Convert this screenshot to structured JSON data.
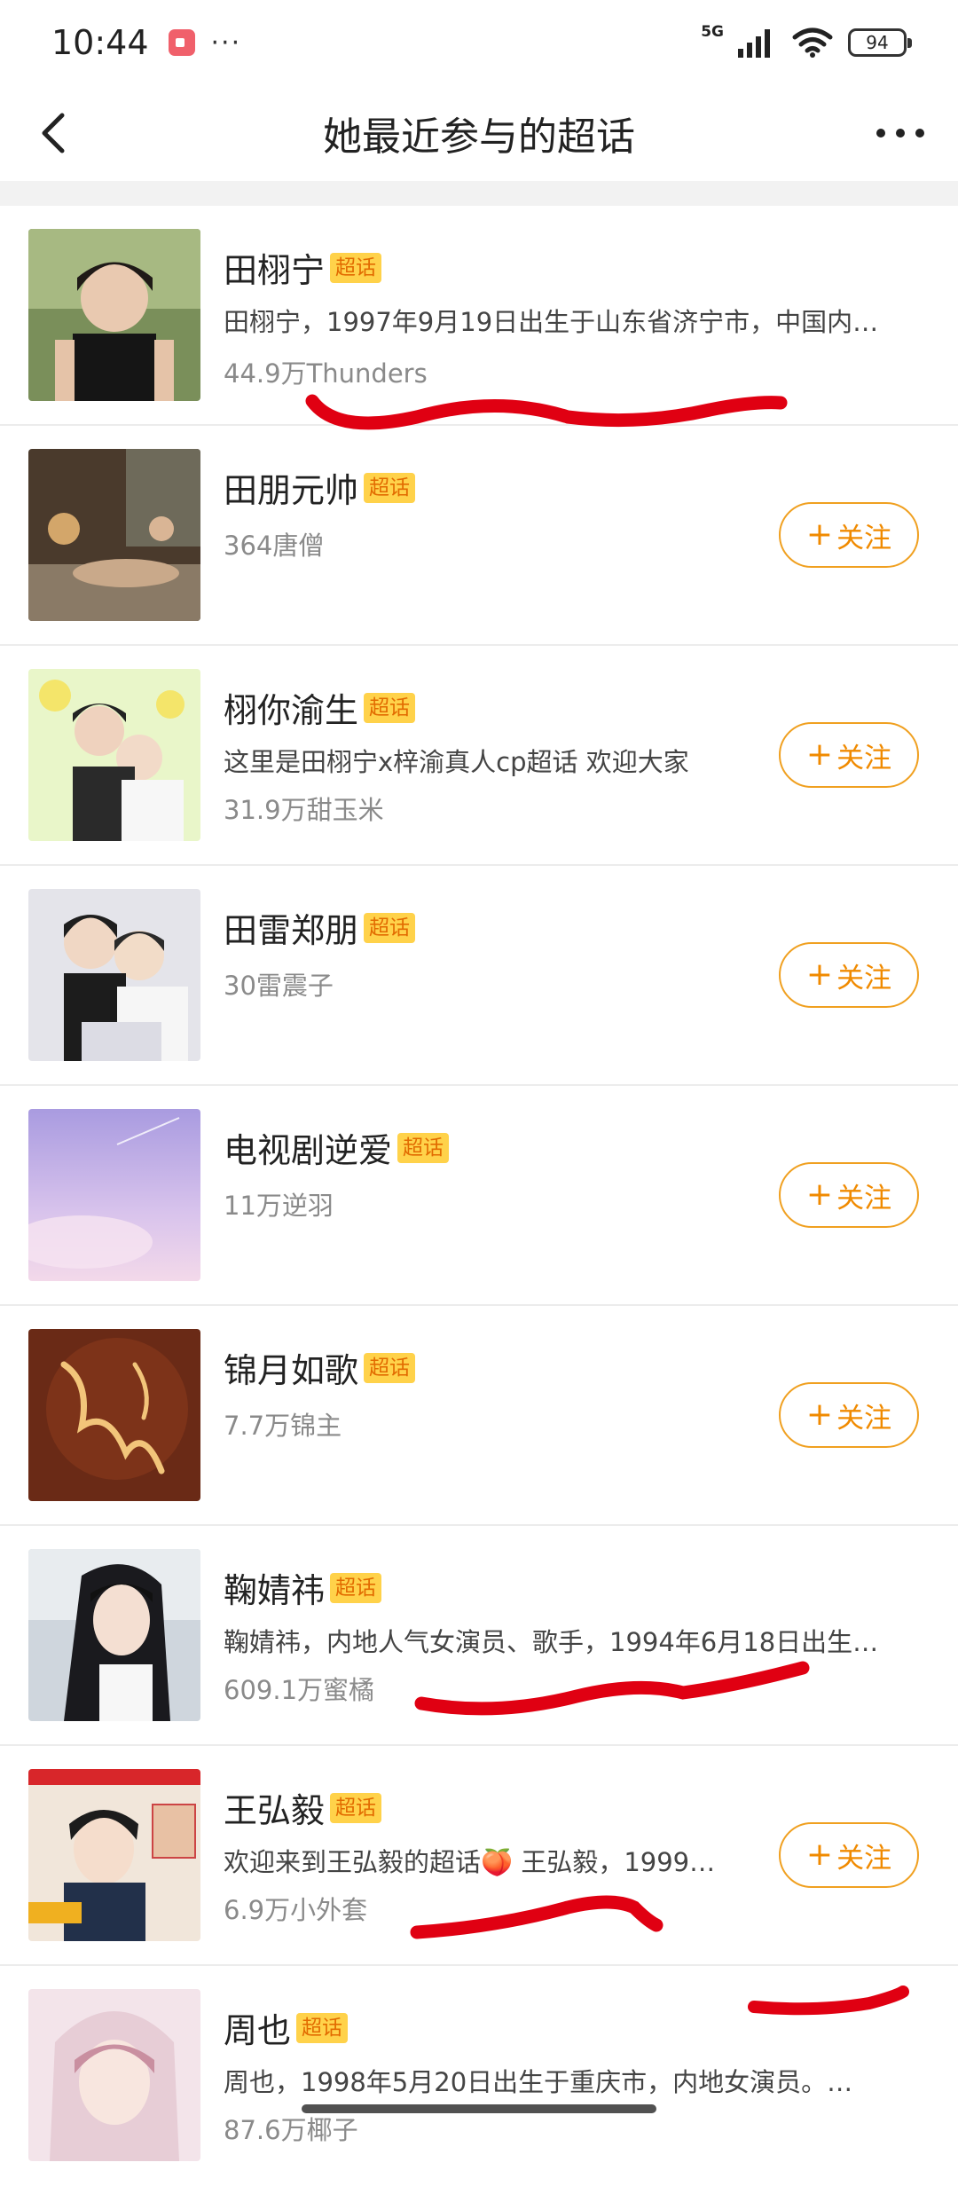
{
  "status_bar": {
    "time": "10:44",
    "more_dots": "···",
    "network": "5G",
    "battery": "94"
  },
  "nav": {
    "title": "她最近参与的超话"
  },
  "topics": [
    {
      "name": "田栩宁",
      "tag": "超话",
      "desc": "田栩宁，1997年9月19日出生于山东省济宁市，中国内…",
      "meta": "44.9万Thunders",
      "follow": null
    },
    {
      "name": "田朋元帅",
      "tag": "超话",
      "desc": "",
      "meta": "364唐僧",
      "follow": "关注"
    },
    {
      "name": "栩你渝生",
      "tag": "超话",
      "desc": "这里是田栩宁x梓渝真人cp超话 欢迎大家",
      "meta": "31.9万甜玉米",
      "follow": "关注"
    },
    {
      "name": "田雷郑朋",
      "tag": "超话",
      "desc": "",
      "meta": "30雷震子",
      "follow": "关注"
    },
    {
      "name": "电视剧逆爱",
      "tag": "超话",
      "desc": "",
      "meta": "11万逆羽",
      "follow": "关注"
    },
    {
      "name": "锦月如歌",
      "tag": "超话",
      "desc": "",
      "meta": "7.7万锦主",
      "follow": "关注"
    },
    {
      "name": "鞠婧祎",
      "tag": "超话",
      "desc": "鞠婧祎，内地人气女演员、歌手，1994年6月18日出生…",
      "meta": "609.1万蜜橘",
      "follow": null
    },
    {
      "name": "王弘毅",
      "tag": "超话",
      "desc": "欢迎来到王弘毅的超话🍑 王弘毅，1999…",
      "meta": "6.9万小外套",
      "follow": "关注"
    },
    {
      "name": "周也",
      "tag": "超话",
      "desc": "周也，1998年5月20日出生于重庆市，内地女演员。…",
      "meta": "87.6万椰子",
      "follow": null
    }
  ],
  "colors": {
    "accent": "#f08a00",
    "tag_bg": "#ffd24a",
    "annotation": "#e00012"
  },
  "icons": [
    "back-arrow-icon",
    "more-icon",
    "plus-icon",
    "record-icon",
    "signal-icon",
    "wifi-icon",
    "battery-icon"
  ]
}
